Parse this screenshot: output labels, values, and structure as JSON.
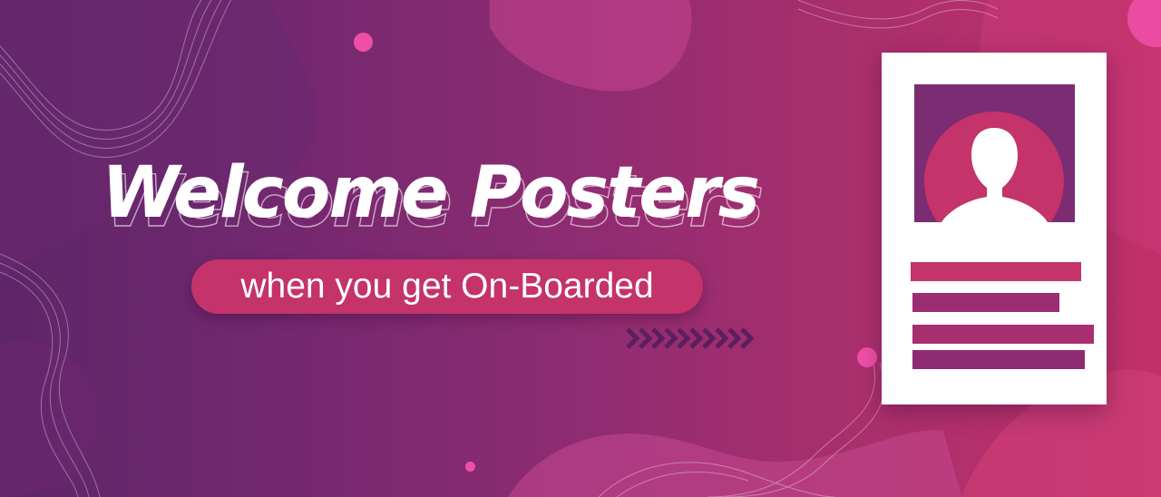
{
  "banner": {
    "title": "Welcome Posters",
    "subtitle": "when you get On-Boarded"
  },
  "icons": {
    "arrows": "chevron-right-arrows-icon",
    "avatar": "person-silhouette-icon"
  },
  "colors": {
    "gradient_left": "#5e2568",
    "gradient_right": "#c13169",
    "accent_pink": "#c4336a",
    "dot_pink": "#ee4fa6",
    "poster_white": "#ffffff",
    "poster_purple": "#7b2c73"
  }
}
